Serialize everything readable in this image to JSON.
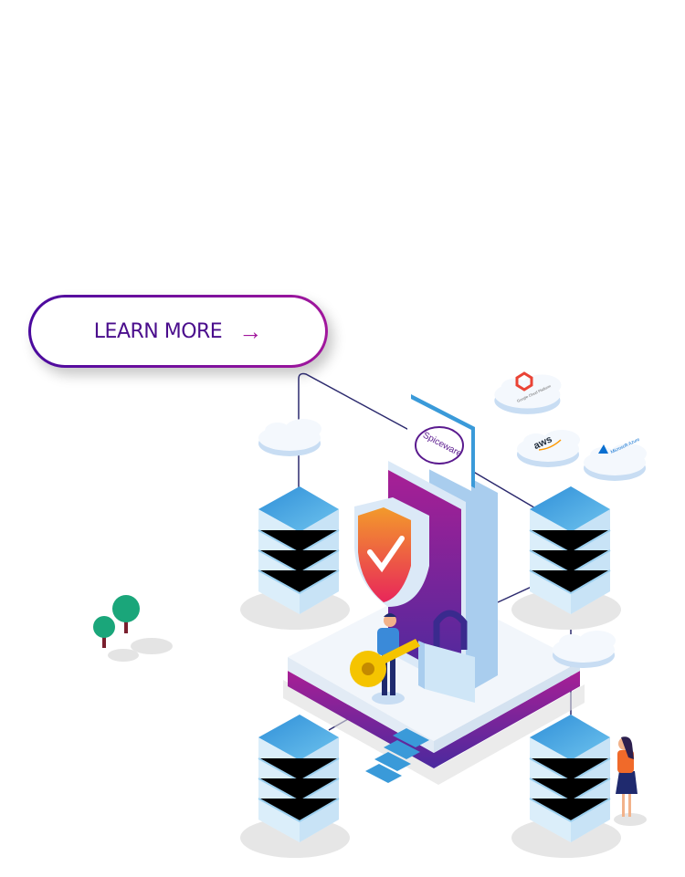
{
  "cta": {
    "label": "LEARN MORE",
    "arrow_icon": "arrow-right-icon"
  },
  "illustration": {
    "brand_logo": "Spiceware",
    "cloud_providers": [
      "Google Cloud Platform",
      "aws",
      "Microsoft Azure"
    ]
  },
  "colors": {
    "purple": "#4a0a9e",
    "magenta": "#a1169c",
    "server_blue": "#3a9ad9",
    "tree_green": "#1aa67a"
  }
}
